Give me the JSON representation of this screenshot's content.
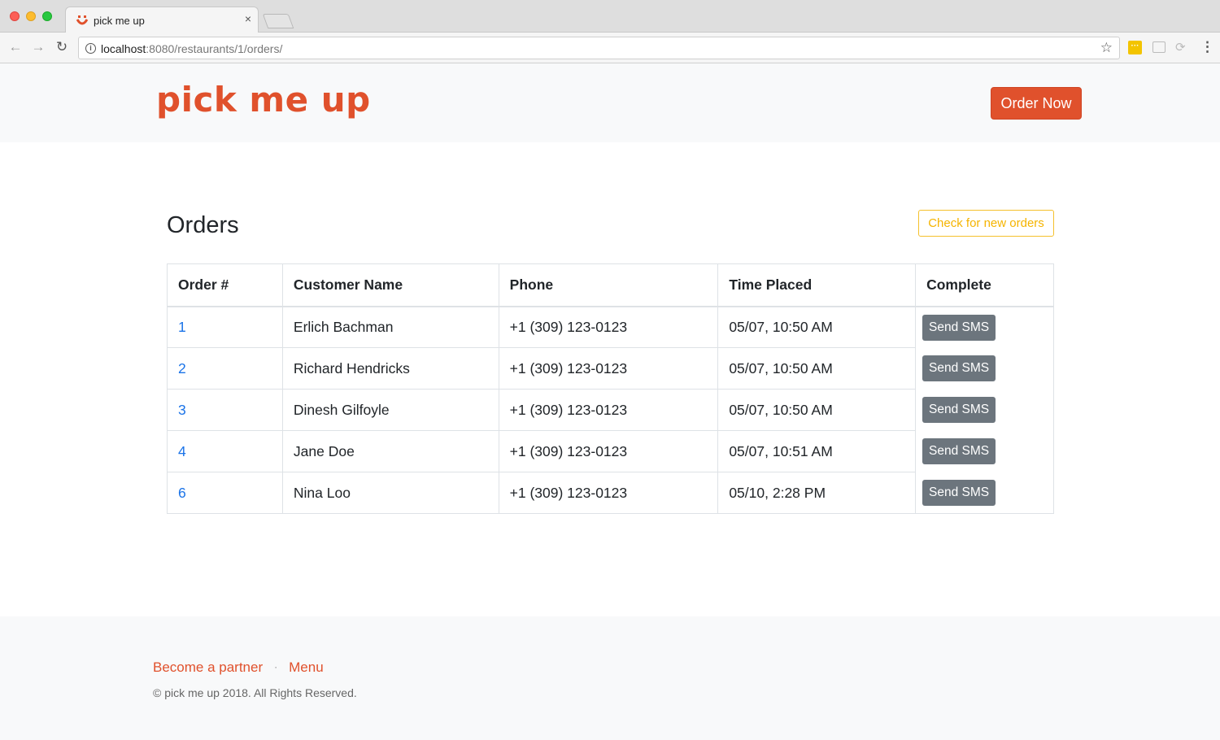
{
  "browser": {
    "tab_title": "pick me up",
    "tab_close": "×",
    "url_host": "localhost",
    "url_path": ":8080/restaurants/1/orders/"
  },
  "header": {
    "logo_text": "pick me up",
    "order_now_label": "Order Now"
  },
  "orders": {
    "title": "Orders",
    "check_label": "Check for new orders",
    "columns": [
      "Order #",
      "Customer Name",
      "Phone",
      "Time Placed",
      "Complete"
    ],
    "rows": [
      {
        "id": "1",
        "name": "Erlich Bachman",
        "phone": "+1 (309) 123-0123",
        "time": "05/07, 10:50 AM",
        "action": "Send SMS"
      },
      {
        "id": "2",
        "name": "Richard Hendricks",
        "phone": "+1 (309) 123-0123",
        "time": "05/07, 10:50 AM",
        "action": "Send SMS"
      },
      {
        "id": "3",
        "name": "Dinesh Gilfoyle",
        "phone": "+1 (309) 123-0123",
        "time": "05/07, 10:50 AM",
        "action": "Send SMS"
      },
      {
        "id": "4",
        "name": "Jane Doe",
        "phone": "+1 (309) 123-0123",
        "time": "05/07, 10:51 AM",
        "action": "Send SMS"
      },
      {
        "id": "6",
        "name": "Nina Loo",
        "phone": "+1 (309) 123-0123",
        "time": "05/10, 2:28 PM",
        "action": "Send SMS"
      }
    ]
  },
  "footer": {
    "link_partner": "Become a partner",
    "separator": "·",
    "link_menu": "Menu",
    "copyright": "© pick me up 2018. All Rights Reserved."
  },
  "colors": {
    "brand": "#e0512c",
    "warning": "#f5b400",
    "secondary": "#6c757d",
    "link": "#1a73e8"
  }
}
